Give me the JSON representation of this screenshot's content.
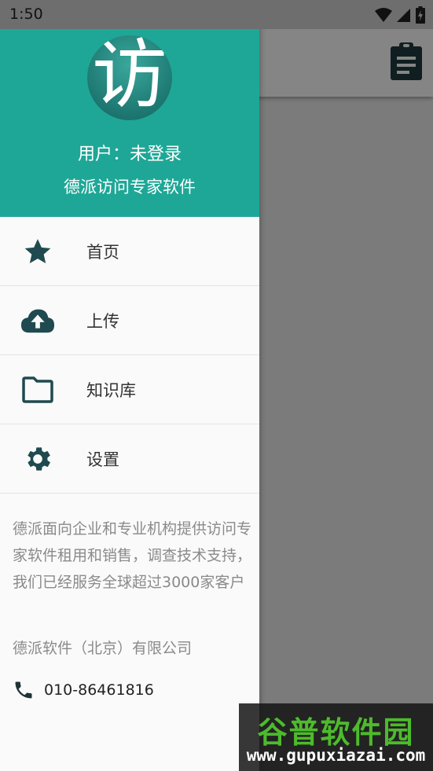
{
  "status_bar": {
    "time": "1:50"
  },
  "app_bar": {
    "action_icon": "clipboard-icon"
  },
  "drawer": {
    "header": {
      "logo_text": "访",
      "user_status": "用户：未登录",
      "subtitle": "德派访问专家软件"
    },
    "menu": [
      {
        "label": "首页",
        "icon": "star-icon"
      },
      {
        "label": "上传",
        "icon": "cloud-upload-icon"
      },
      {
        "label": "知识库",
        "icon": "folder-icon"
      },
      {
        "label": "设置",
        "icon": "gear-icon"
      }
    ],
    "about_text": "德派面向企业和专业机构提供访问专家软件租用和销售，调查技术支持，我们已经服务全球超过3000家客户",
    "company_name": "德派软件（北京）有限公司",
    "phone": "010-86461816"
  },
  "watermark": {
    "title": "谷普软件园",
    "url": "www.gupuxiazai.com"
  },
  "colors": {
    "header_teal": "#1ea796",
    "icon_dark": "#1f4a4f",
    "scrim": "#7b7b7b"
  }
}
